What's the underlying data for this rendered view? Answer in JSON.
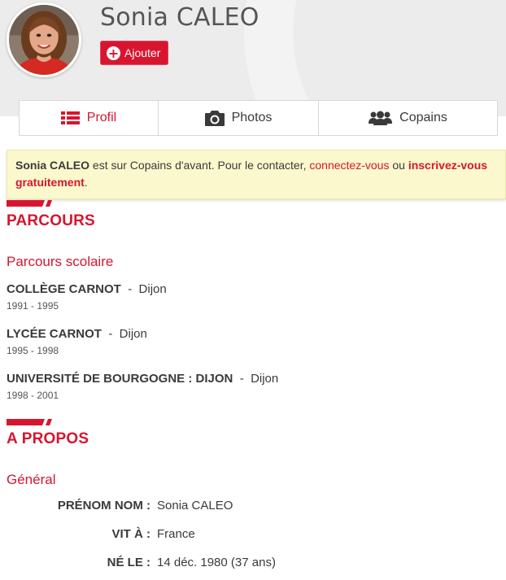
{
  "profile": {
    "name": "Sonia CALEO",
    "add_button": "Ajouter"
  },
  "tabs": [
    {
      "label": "Profil",
      "icon": "list-icon",
      "active": true
    },
    {
      "label": "Photos",
      "icon": "camera-icon",
      "active": false
    },
    {
      "label": "Copains",
      "icon": "users-icon",
      "active": false
    }
  ],
  "notice": {
    "name": "Sonia CALEO",
    "text1": " est sur Copains d'avant. Pour le contacter, ",
    "link1": "connectez-vous",
    "text2": " ou ",
    "link2": "inscrivez-vous gratuitement",
    "text3": "."
  },
  "parcours": {
    "title": "PARCOURS",
    "subtitle": "Parcours scolaire",
    "schools": [
      {
        "name": "COLLÈGE CARNOT",
        "sep": "-",
        "city": "Dijon",
        "years": "1991 - 1995"
      },
      {
        "name": "LYCÉE CARNOT",
        "sep": "-",
        "city": "Dijon",
        "years": "1995 - 1998"
      },
      {
        "name": "UNIVERSITÉ DE BOURGOGNE : DIJON",
        "sep": "-",
        "city": "Dijon",
        "years": "1998 - 2001"
      }
    ]
  },
  "apropos": {
    "title": "A PROPOS",
    "subtitle": "Général",
    "rows": [
      {
        "label": "PRÉNOM NOM :",
        "value": "Sonia CALEO"
      },
      {
        "label": "VIT À :",
        "value": "France"
      },
      {
        "label": "NÉ LE :",
        "value": "14 déc. 1980 (37 ans)"
      }
    ]
  },
  "colors": {
    "accent": "#d8152f",
    "notice_bg": "#fbf8cd",
    "header_bg": "#ececec"
  }
}
